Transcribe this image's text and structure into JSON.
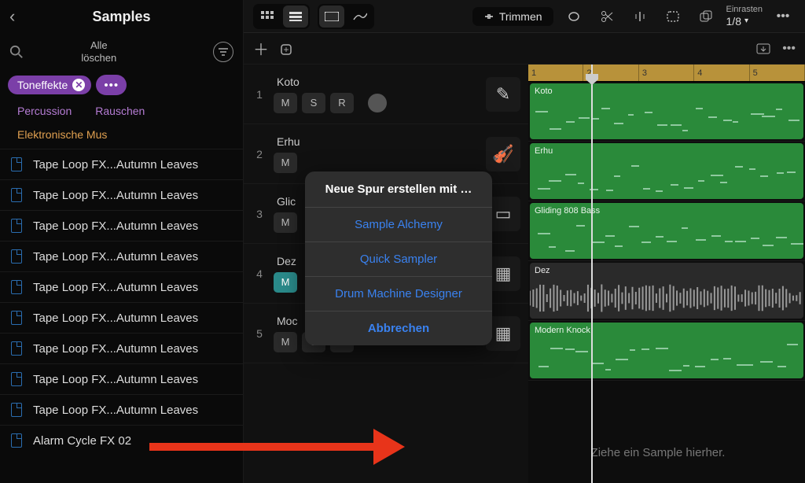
{
  "sidebar": {
    "title": "Samples",
    "clear_all_line1": "Alle",
    "clear_all_line2": "löschen",
    "active_tag": "Toneffekte",
    "sub_tags": [
      "Percussion",
      "Rauschen",
      "Elektronische Mus"
    ],
    "samples": [
      "Tape Loop FX...Autumn Leaves",
      "Tape Loop FX...Autumn Leaves",
      "Tape Loop FX...Autumn Leaves",
      "Tape Loop FX...Autumn Leaves",
      "Tape Loop FX...Autumn Leaves",
      "Tape Loop FX...Autumn Leaves",
      "Tape Loop FX...Autumn Leaves",
      "Tape Loop FX...Autumn Leaves",
      "Tape Loop FX...Autumn Leaves",
      "Alarm Cycle FX 02"
    ]
  },
  "toolbar": {
    "trim": "Trimmen",
    "snap_label": "Einrasten",
    "snap_value": "1/8"
  },
  "tracks": [
    {
      "num": "1",
      "name": "Koto",
      "m": "M",
      "s": "S",
      "r": "R",
      "region": "Koto",
      "color": "green",
      "icon": "pencil"
    },
    {
      "num": "2",
      "name": "Erhu",
      "m": "M",
      "s": "",
      "r": "",
      "region": "Erhu",
      "color": "green",
      "icon": "string"
    },
    {
      "num": "3",
      "name": "Glic",
      "m": "M",
      "s": "",
      "r": "",
      "region": "Gliding 808 Bass",
      "color": "green",
      "icon": "synth"
    },
    {
      "num": "4",
      "name": "Dez",
      "m": "M",
      "s": "",
      "r": "",
      "region": "Dez",
      "color": "dark",
      "icon": "drum",
      "teal": true
    },
    {
      "num": "5",
      "name": "Moc",
      "m": "M",
      "s": "S",
      "r": "R",
      "region": "Modern Knock",
      "color": "green",
      "icon": "drum",
      "r_red": true
    }
  ],
  "ruler": [
    "1",
    "2",
    "3",
    "4",
    "5"
  ],
  "popup": {
    "title": "Neue Spur erstellen mit …",
    "items": [
      "Sample Alchemy",
      "Quick Sampler",
      "Drum Machine Designer",
      "Abbrechen"
    ]
  },
  "drop_hint": "Ziehe ein Sample hierher."
}
